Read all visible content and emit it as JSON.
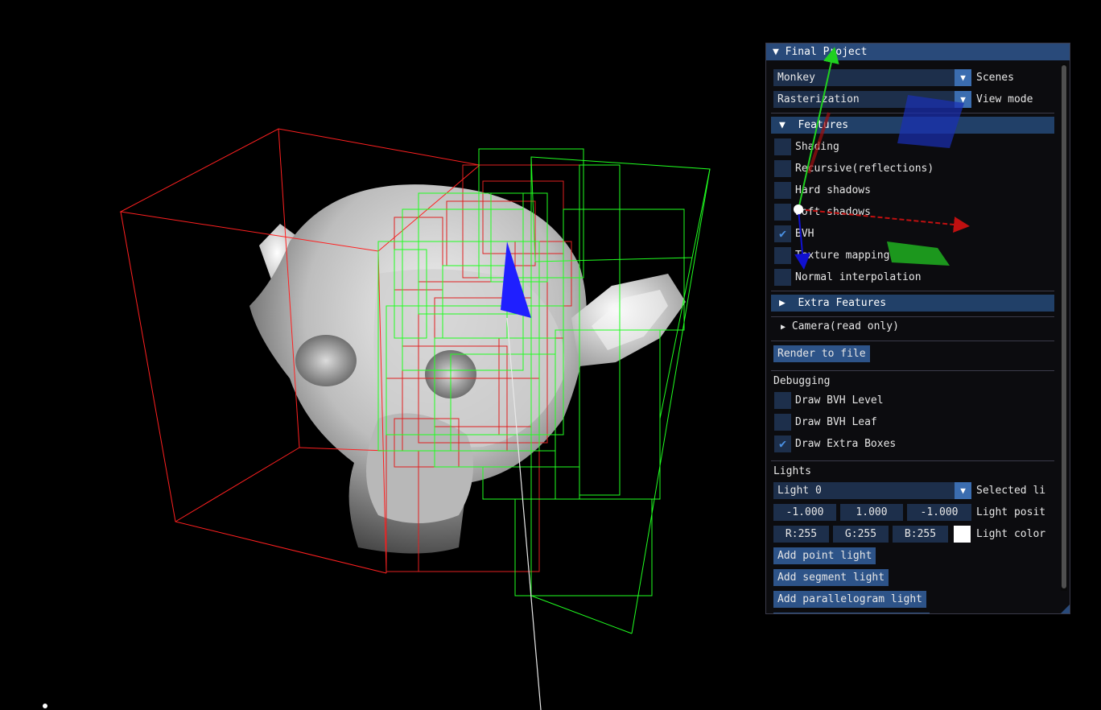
{
  "window": {
    "title": "Final Project"
  },
  "scene_combo": {
    "value": "Monkey",
    "label": "Scenes"
  },
  "viewmode_combo": {
    "value": "Rasterization",
    "label": "View mode"
  },
  "features": {
    "header": "Features",
    "items": [
      {
        "label": "Shading",
        "checked": false
      },
      {
        "label": "Recursive(reflections)",
        "checked": false
      },
      {
        "label": "Hard shadows",
        "checked": false
      },
      {
        "label": "Soft shadows",
        "checked": false
      },
      {
        "label": "BVH",
        "checked": true
      },
      {
        "label": "Texture mapping",
        "checked": false
      },
      {
        "label": "Normal interpolation",
        "checked": false
      }
    ]
  },
  "extra_features": {
    "header": "Extra Features"
  },
  "camera": {
    "label": "Camera(read only)"
  },
  "render_button": "Render to file",
  "debugging": {
    "title": "Debugging",
    "items": [
      {
        "label": "Draw BVH Level",
        "checked": false
      },
      {
        "label": "Draw BVH Leaf",
        "checked": false
      },
      {
        "label": "Draw Extra Boxes",
        "checked": true
      }
    ]
  },
  "lights": {
    "title": "Lights",
    "selected": {
      "value": "Light 0",
      "label": "Selected li"
    },
    "position": {
      "values": [
        "-1.000",
        "1.000",
        "-1.000"
      ],
      "label": "Light posit"
    },
    "color": {
      "values": [
        "R:255",
        "G:255",
        "B:255"
      ],
      "label": "Light color",
      "swatch": "#ffffff"
    },
    "buttons": [
      "Add point light",
      "Add segment light",
      "Add parallelogram light"
    ]
  },
  "colors": {
    "accent": "#294a7a",
    "bvh_red": "#ff2020",
    "bvh_green": "#20ff20",
    "checkmark": "#4a90e2"
  },
  "icons": {
    "collapse_open": "triangle-down-icon",
    "collapse_closed": "triangle-right-icon",
    "combo": "chevron-down-icon",
    "check": "checkmark-icon"
  }
}
